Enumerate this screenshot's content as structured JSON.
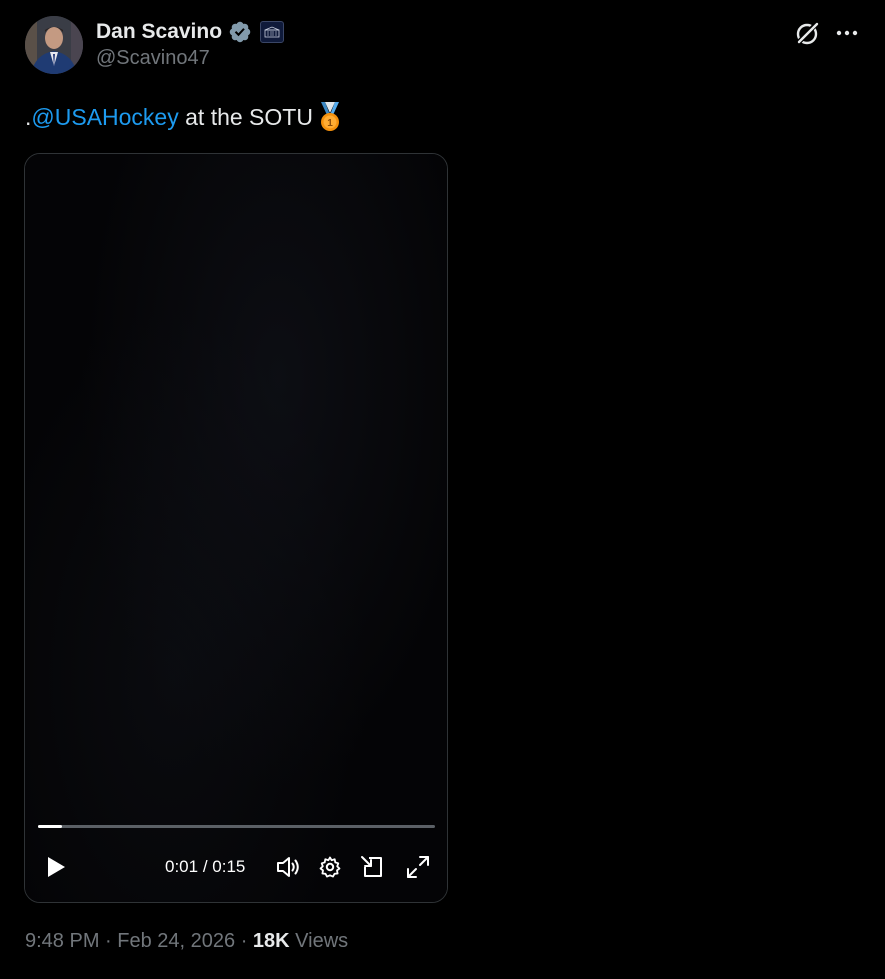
{
  "author": {
    "display_name": "Dan Scavino",
    "handle": "@Scavino47",
    "verified_icon": "verified-badge-icon",
    "verified_color": "#829aab",
    "affiliate_badge": "white-house-badge-icon"
  },
  "header_actions": {
    "grok_icon": "grok-icon",
    "more_icon": "more-horizontal-icon"
  },
  "tweet": {
    "prefix": ".",
    "mention": "@USAHockey",
    "suffix": " at the SOTU",
    "emoji": "first-place-medal-icon",
    "mention_color": "#1d9bf0"
  },
  "video": {
    "current_time": "0:01",
    "duration": "0:15",
    "time_separator": " / ",
    "progress_fraction": 0.06,
    "controls": [
      "play-icon",
      "volume-icon",
      "settings-icon",
      "dock-icon",
      "fullscreen-icon"
    ]
  },
  "meta": {
    "time": "9:48 PM",
    "separator": " · ",
    "date": "Feb 24, 2026",
    "views_count": "18K",
    "views_label": " Views"
  },
  "colors": {
    "background": "#000000",
    "text_primary": "#e7e9ea",
    "text_secondary": "#71767b",
    "accent": "#1d9bf0",
    "border": "#2f3336"
  }
}
